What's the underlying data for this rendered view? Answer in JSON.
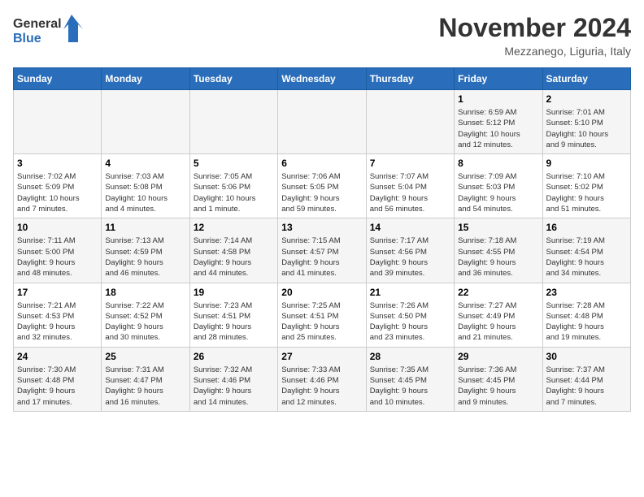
{
  "logo": {
    "line1": "General",
    "line2": "Blue"
  },
  "title": "November 2024",
  "location": "Mezzanego, Liguria, Italy",
  "weekdays": [
    "Sunday",
    "Monday",
    "Tuesday",
    "Wednesday",
    "Thursday",
    "Friday",
    "Saturday"
  ],
  "weeks": [
    [
      {
        "day": "",
        "info": ""
      },
      {
        "day": "",
        "info": ""
      },
      {
        "day": "",
        "info": ""
      },
      {
        "day": "",
        "info": ""
      },
      {
        "day": "",
        "info": ""
      },
      {
        "day": "1",
        "info": "Sunrise: 6:59 AM\nSunset: 5:12 PM\nDaylight: 10 hours\nand 12 minutes."
      },
      {
        "day": "2",
        "info": "Sunrise: 7:01 AM\nSunset: 5:10 PM\nDaylight: 10 hours\nand 9 minutes."
      }
    ],
    [
      {
        "day": "3",
        "info": "Sunrise: 7:02 AM\nSunset: 5:09 PM\nDaylight: 10 hours\nand 7 minutes."
      },
      {
        "day": "4",
        "info": "Sunrise: 7:03 AM\nSunset: 5:08 PM\nDaylight: 10 hours\nand 4 minutes."
      },
      {
        "day": "5",
        "info": "Sunrise: 7:05 AM\nSunset: 5:06 PM\nDaylight: 10 hours\nand 1 minute."
      },
      {
        "day": "6",
        "info": "Sunrise: 7:06 AM\nSunset: 5:05 PM\nDaylight: 9 hours\nand 59 minutes."
      },
      {
        "day": "7",
        "info": "Sunrise: 7:07 AM\nSunset: 5:04 PM\nDaylight: 9 hours\nand 56 minutes."
      },
      {
        "day": "8",
        "info": "Sunrise: 7:09 AM\nSunset: 5:03 PM\nDaylight: 9 hours\nand 54 minutes."
      },
      {
        "day": "9",
        "info": "Sunrise: 7:10 AM\nSunset: 5:02 PM\nDaylight: 9 hours\nand 51 minutes."
      }
    ],
    [
      {
        "day": "10",
        "info": "Sunrise: 7:11 AM\nSunset: 5:00 PM\nDaylight: 9 hours\nand 48 minutes."
      },
      {
        "day": "11",
        "info": "Sunrise: 7:13 AM\nSunset: 4:59 PM\nDaylight: 9 hours\nand 46 minutes."
      },
      {
        "day": "12",
        "info": "Sunrise: 7:14 AM\nSunset: 4:58 PM\nDaylight: 9 hours\nand 44 minutes."
      },
      {
        "day": "13",
        "info": "Sunrise: 7:15 AM\nSunset: 4:57 PM\nDaylight: 9 hours\nand 41 minutes."
      },
      {
        "day": "14",
        "info": "Sunrise: 7:17 AM\nSunset: 4:56 PM\nDaylight: 9 hours\nand 39 minutes."
      },
      {
        "day": "15",
        "info": "Sunrise: 7:18 AM\nSunset: 4:55 PM\nDaylight: 9 hours\nand 36 minutes."
      },
      {
        "day": "16",
        "info": "Sunrise: 7:19 AM\nSunset: 4:54 PM\nDaylight: 9 hours\nand 34 minutes."
      }
    ],
    [
      {
        "day": "17",
        "info": "Sunrise: 7:21 AM\nSunset: 4:53 PM\nDaylight: 9 hours\nand 32 minutes."
      },
      {
        "day": "18",
        "info": "Sunrise: 7:22 AM\nSunset: 4:52 PM\nDaylight: 9 hours\nand 30 minutes."
      },
      {
        "day": "19",
        "info": "Sunrise: 7:23 AM\nSunset: 4:51 PM\nDaylight: 9 hours\nand 28 minutes."
      },
      {
        "day": "20",
        "info": "Sunrise: 7:25 AM\nSunset: 4:51 PM\nDaylight: 9 hours\nand 25 minutes."
      },
      {
        "day": "21",
        "info": "Sunrise: 7:26 AM\nSunset: 4:50 PM\nDaylight: 9 hours\nand 23 minutes."
      },
      {
        "day": "22",
        "info": "Sunrise: 7:27 AM\nSunset: 4:49 PM\nDaylight: 9 hours\nand 21 minutes."
      },
      {
        "day": "23",
        "info": "Sunrise: 7:28 AM\nSunset: 4:48 PM\nDaylight: 9 hours\nand 19 minutes."
      }
    ],
    [
      {
        "day": "24",
        "info": "Sunrise: 7:30 AM\nSunset: 4:48 PM\nDaylight: 9 hours\nand 17 minutes."
      },
      {
        "day": "25",
        "info": "Sunrise: 7:31 AM\nSunset: 4:47 PM\nDaylight: 9 hours\nand 16 minutes."
      },
      {
        "day": "26",
        "info": "Sunrise: 7:32 AM\nSunset: 4:46 PM\nDaylight: 9 hours\nand 14 minutes."
      },
      {
        "day": "27",
        "info": "Sunrise: 7:33 AM\nSunset: 4:46 PM\nDaylight: 9 hours\nand 12 minutes."
      },
      {
        "day": "28",
        "info": "Sunrise: 7:35 AM\nSunset: 4:45 PM\nDaylight: 9 hours\nand 10 minutes."
      },
      {
        "day": "29",
        "info": "Sunrise: 7:36 AM\nSunset: 4:45 PM\nDaylight: 9 hours\nand 9 minutes."
      },
      {
        "day": "30",
        "info": "Sunrise: 7:37 AM\nSunset: 4:44 PM\nDaylight: 9 hours\nand 7 minutes."
      }
    ]
  ]
}
